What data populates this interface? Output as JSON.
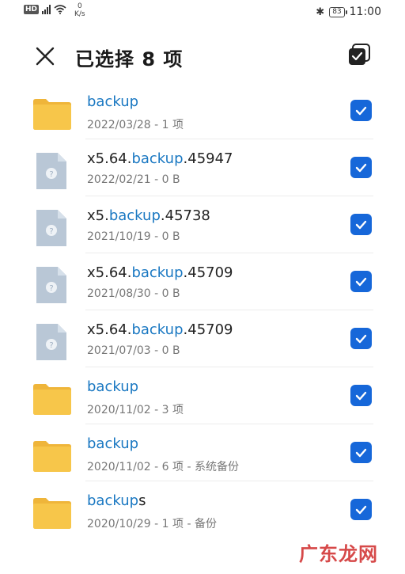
{
  "status_bar": {
    "hd_label": "HD",
    "net_speed": "0",
    "net_unit": "K/s",
    "battery": "83",
    "time": "11:00"
  },
  "header": {
    "title": "已选择 8 项"
  },
  "colors": {
    "accent": "#1667d9",
    "highlight_text": "#1a78c2",
    "folder": "#f7c64a",
    "file_icon": "#b9c7d6"
  },
  "files": [
    {
      "type": "folder",
      "name_pre": "",
      "name_hl": "backup",
      "name_post": "",
      "meta": "2022/03/28 - 1 项",
      "checked": true
    },
    {
      "type": "file",
      "name_pre": "x5.64.",
      "name_hl": "backup",
      "name_post": ".45947",
      "meta": "2022/02/21 - 0 B",
      "checked": true
    },
    {
      "type": "file",
      "name_pre": "x5.",
      "name_hl": "backup",
      "name_post": ".45738",
      "meta": "2021/10/19 - 0 B",
      "checked": true
    },
    {
      "type": "file",
      "name_pre": "x5.64.",
      "name_hl": "backup",
      "name_post": ".45709",
      "meta": "2021/08/30 - 0 B",
      "checked": true
    },
    {
      "type": "file",
      "name_pre": "x5.64.",
      "name_hl": "backup",
      "name_post": ".45709",
      "meta": "2021/07/03 - 0 B",
      "checked": true
    },
    {
      "type": "folder",
      "name_pre": "",
      "name_hl": "backup",
      "name_post": "",
      "meta": "2020/11/02 - 3 项",
      "checked": true
    },
    {
      "type": "folder",
      "name_pre": "",
      "name_hl": "backup",
      "name_post": "",
      "meta": "2020/11/02 - 6 项 - 系统备份",
      "checked": true
    },
    {
      "type": "folder",
      "name_pre": "",
      "name_hl": "backup",
      "name_post": "s",
      "meta": "2020/10/29 - 1 项 - 备份",
      "checked": true
    }
  ],
  "watermark": "广东龙网"
}
